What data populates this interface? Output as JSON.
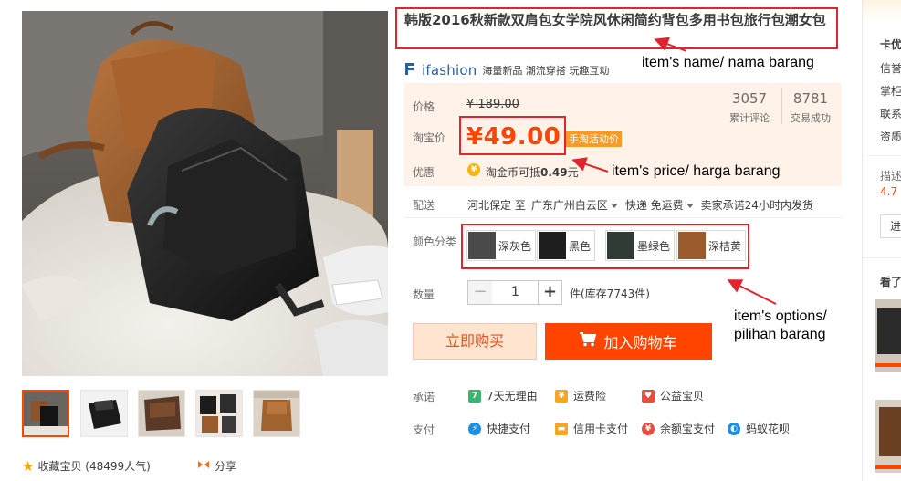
{
  "product": {
    "title": "韩版2016秋新款双肩包女学院风休闲简约背包多用书包旅行包潮女包",
    "brand_logo": "ifashion",
    "brand_tagline": "海量新品 潮流穿搭 玩趣互动"
  },
  "price": {
    "label_orig": "价格",
    "orig": "¥ 189.00",
    "label_now": "淘宝价",
    "now": "¥49.00",
    "promo_badge": "手淘活动价",
    "reviews_count": "3057",
    "reviews_label": "累计评论",
    "sales_count": "8781",
    "sales_label": "交易成功",
    "discount_label": "优惠",
    "coin_text_pre": "淘金币可抵",
    "coin_amount": "0.49",
    "coin_unit": "元"
  },
  "shipping": {
    "label": "配送",
    "from": "河北保定 至",
    "to": "广东广州白云区",
    "express": "快递 免运费",
    "promise": "卖家承诺24小时内发货"
  },
  "options": {
    "label": "颜色分类",
    "items": [
      {
        "label": "深灰色",
        "swatch": "#4a4a4a"
      },
      {
        "label": "黑色",
        "swatch": "#1e1e1e"
      },
      {
        "label": "墨绿色",
        "swatch": "#2f3b34"
      },
      {
        "label": "深桔黄",
        "swatch": "#9a5a2c"
      }
    ]
  },
  "quantity": {
    "label": "数量",
    "value": "1",
    "minus": "−",
    "plus": "+",
    "stock": "件(库存7743件)"
  },
  "actions": {
    "buy_now": "立即购买",
    "add_cart": "加入购物车"
  },
  "services": {
    "promise_label": "承诺",
    "promises": [
      "7天无理由",
      "运费险",
      "公益宝贝"
    ],
    "pay_label": "支付",
    "payments": [
      "快捷支付",
      "信用卡支付",
      "余额宝支付",
      "蚂蚁花呗"
    ]
  },
  "gallery": {
    "favorite": "收藏宝贝 (48499人气)",
    "share": "分享"
  },
  "annotations": {
    "name": "item's name/ nama barang",
    "price": "item's price/ harga barang",
    "options_line1": "item's options/",
    "options_line2": "pilihan barang"
  },
  "sidebar": {
    "shop": "卡优",
    "items": [
      "信誉",
      "掌柜",
      "联系",
      "资质"
    ],
    "desc": "描述",
    "score": "4.7",
    "enter": "进",
    "seen": "看了"
  },
  "colors": {
    "accent": "#ff4400",
    "price": "#ff4400",
    "annotation_box": "#e0262c",
    "panel_bg": "#fff2e8"
  }
}
